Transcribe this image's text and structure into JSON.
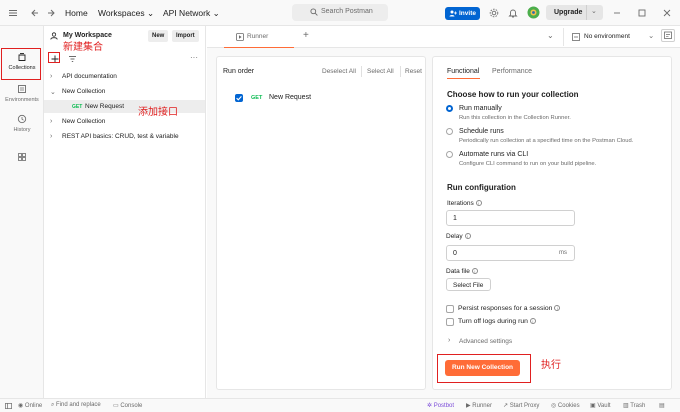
{
  "header": {
    "home": "Home",
    "workspaces": "Workspaces",
    "api_network": "API Network",
    "search_placeholder": "Search Postman",
    "invite": "Invite",
    "upgrade": "Upgrade"
  },
  "rail": {
    "collections": "Collections",
    "environments": "Environments",
    "history": "History"
  },
  "sidebar": {
    "workspace": "My Workspace",
    "new": "New",
    "import": "Import",
    "tree": [
      "API documentation",
      "New Collection",
      "New Request",
      "New Collection",
      "REST API basics: CRUD, test & variable"
    ],
    "request_method": "GET"
  },
  "tabs": {
    "runner": "Runner",
    "environment": "No environment"
  },
  "run_order": {
    "title": "Run order",
    "deselect_all": "Deselect All",
    "select_all": "Select All",
    "reset": "Reset",
    "item_method": "GET",
    "item_name": "New Request"
  },
  "config": {
    "tab_functional": "Functional",
    "tab_performance": "Performance",
    "choose_heading": "Choose how to run your collection",
    "options": [
      {
        "title": "Run manually",
        "desc": "Run this collection in the Collection Runner."
      },
      {
        "title": "Schedule runs",
        "desc": "Periodically run collection at a specified time on the Postman Cloud."
      },
      {
        "title": "Automate runs via CLI",
        "desc": "Configure CLI command to run on your build pipeline."
      }
    ],
    "run_config_heading": "Run configuration",
    "iterations_label": "Iterations",
    "iterations_value": "1",
    "delay_label": "Delay",
    "delay_value": "0",
    "delay_unit": "ms",
    "data_file_label": "Data file",
    "select_file": "Select File",
    "persist": "Persist responses for a session",
    "turn_off_logs": "Turn off logs during run",
    "advanced": "Advanced settings",
    "run_button": "Run New Collection"
  },
  "status": {
    "online": "Online",
    "find_replace": "Find and replace",
    "console": "Console",
    "postbot": "Postbot",
    "runner": "Runner",
    "start_proxy": "Start Proxy",
    "cookies": "Cookies",
    "vault": "Vault",
    "trash": "Trash"
  },
  "annotations": {
    "new_collection": "新建集合",
    "add_endpoint": "添加接口",
    "execute": "执行"
  },
  "colors": {
    "accent_blue": "#0265d2",
    "run_orange": "#ff6c37",
    "annotation_red": "#e02020",
    "get_green": "#0cbb52"
  }
}
